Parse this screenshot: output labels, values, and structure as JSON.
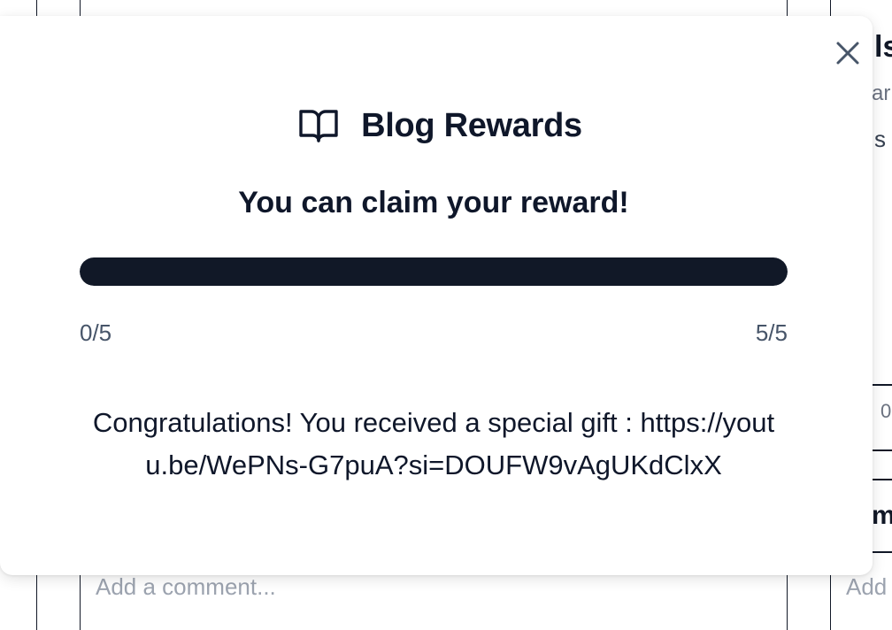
{
  "modal": {
    "title": "Blog Rewards",
    "status": "You can claim your reward!",
    "progress": {
      "value": 5,
      "max": 5,
      "fraction": 1.0,
      "min_label": "0/5",
      "max_label": "5/5"
    },
    "message": "Congratulations! You received a special gift : https://youtu.be/WePNs-G7puA?si=DOUFW9vAgUKdClxX"
  },
  "background": {
    "comment_placeholder": "Add a comment...",
    "right_comment_placeholder": "Add",
    "right_title_fragment": "ls",
    "right_subtitle_fragment": "ar",
    "right_text_fragment": "s",
    "right_number_fragment": "0",
    "right_heading_fragment": "m"
  },
  "icons": {
    "close": "close-icon",
    "book": "book-open-icon"
  },
  "colors": {
    "text_primary": "#0f172a",
    "progress_fill": "#111827",
    "muted": "#475569",
    "placeholder": "#9ca3af"
  }
}
